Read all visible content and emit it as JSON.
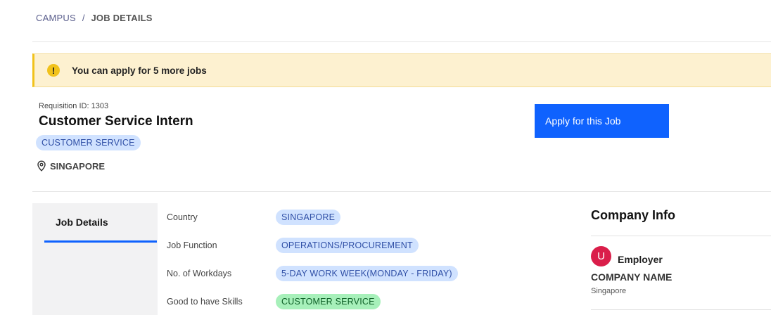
{
  "breadcrumb": {
    "parent": "CAMPUS",
    "separator": "/",
    "current": "JOB DETAILS"
  },
  "banner": {
    "icon": "warning-icon",
    "icon_glyph": "!",
    "text": "You can apply for 5 more jobs"
  },
  "job": {
    "requisition": "Requisition ID: 1303",
    "title": "Customer Service Intern",
    "category_tag": "CUSTOMER SERVICE",
    "location": "SINGAPORE",
    "apply_label": "Apply for this Job"
  },
  "tabs": {
    "active": "Job Details"
  },
  "details": [
    {
      "label": "Country",
      "value": "SINGAPORE",
      "style": "blue"
    },
    {
      "label": "Job Function",
      "value": "OPERATIONS/PROCUREMENT",
      "style": "blue"
    },
    {
      "label": "No. of Workdays",
      "value": "5-DAY WORK WEEK(MONDAY - FRIDAY)",
      "style": "blue"
    },
    {
      "label": "Good to have Skills",
      "value": "CUSTOMER SERVICE",
      "style": "green"
    }
  ],
  "company": {
    "heading": "Company Info",
    "avatar_letter": "U",
    "employer_label": "Employer",
    "name": "COMPANY NAME",
    "location": "Singapore"
  },
  "colors": {
    "accent": "#0f62fe",
    "tag_blue_bg": "#d0e2ff",
    "tag_green_bg": "#a7f0ba",
    "banner_bg": "#fdf1d0",
    "avatar_bg": "#da1e4a"
  }
}
